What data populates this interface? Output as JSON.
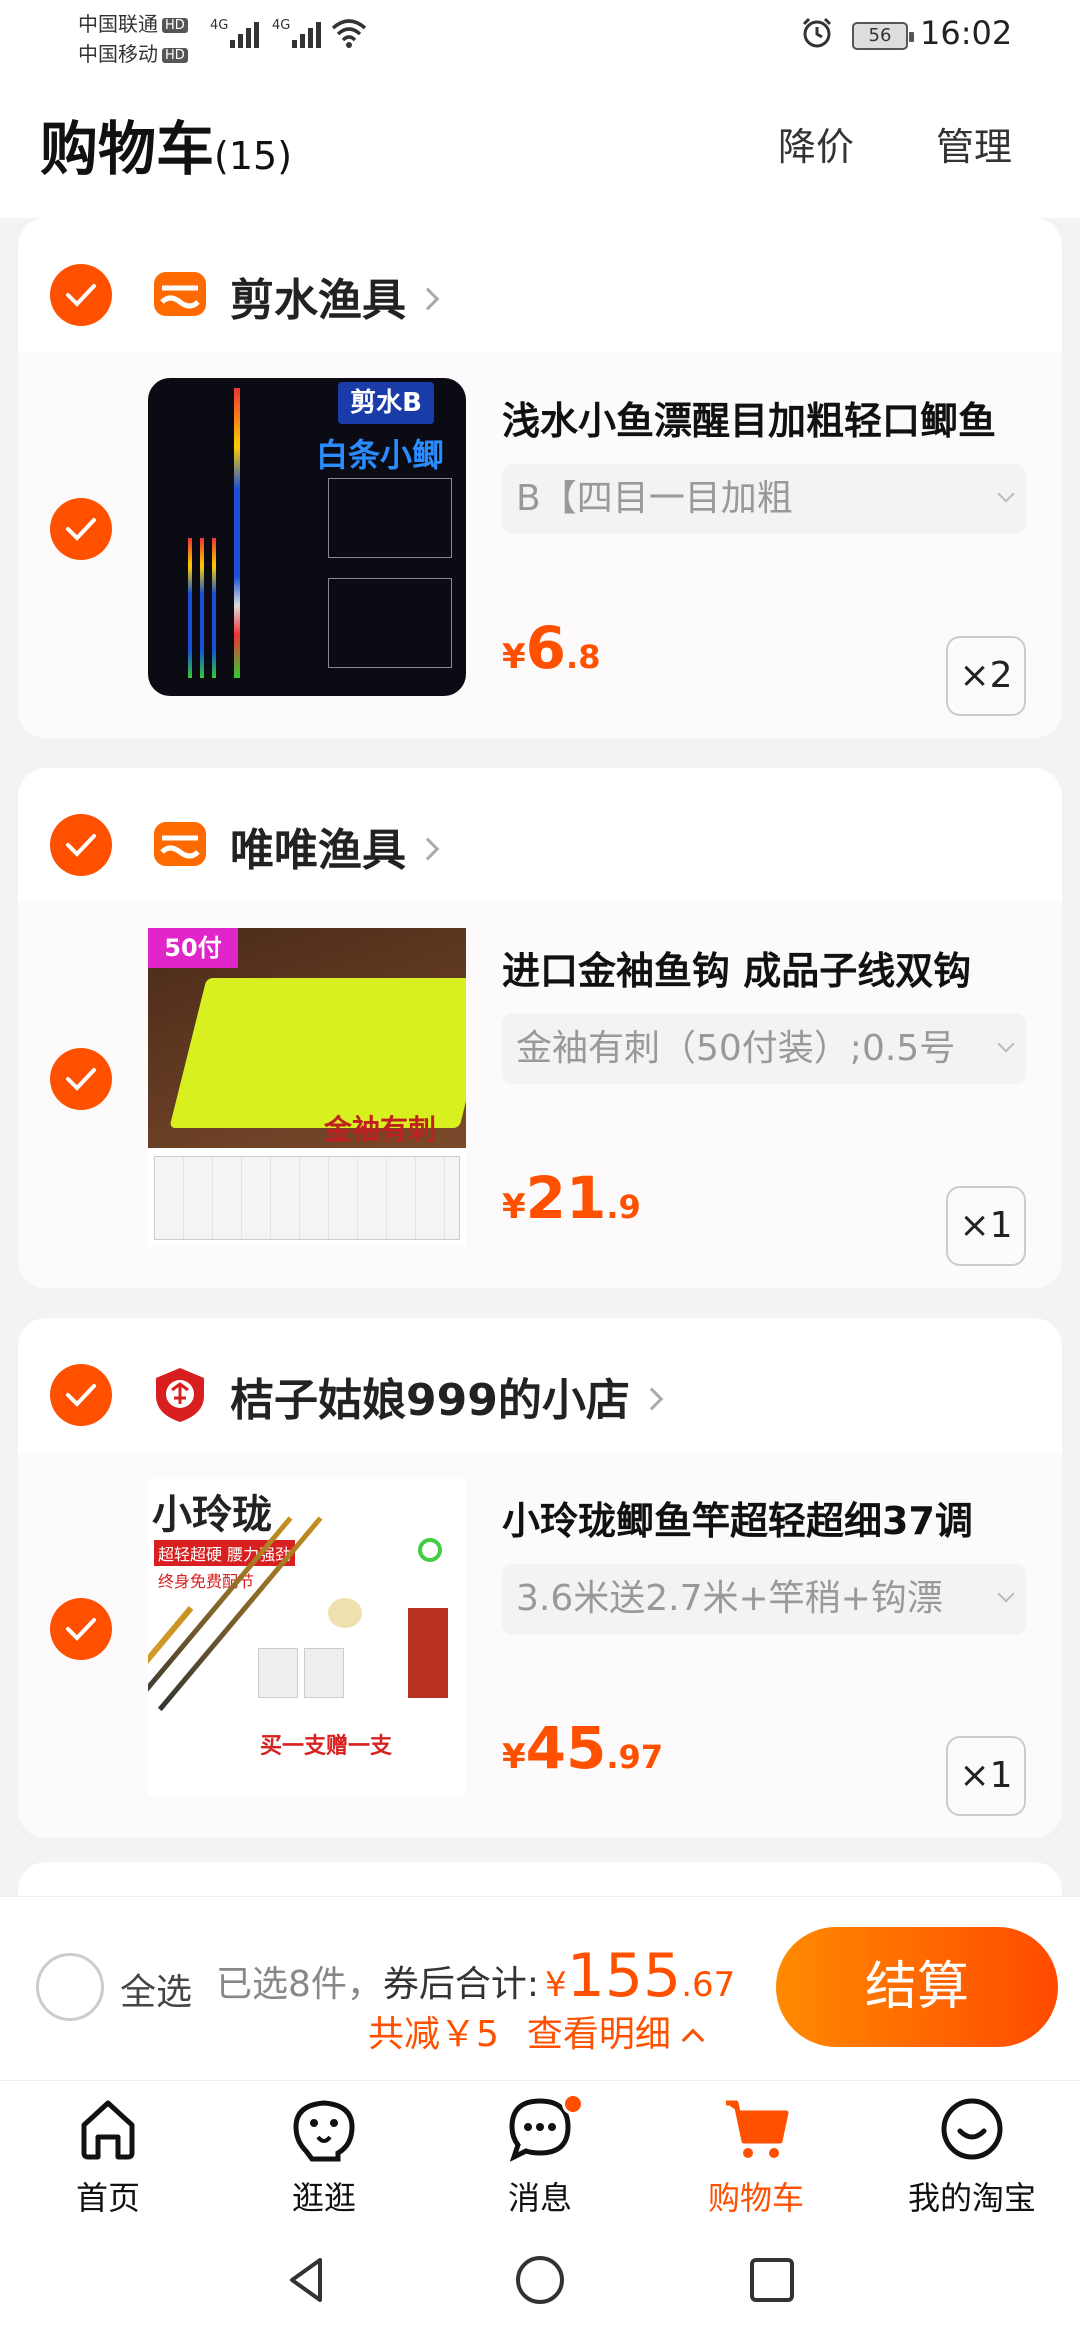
{
  "status_bar": {
    "carrier1": "中国联通",
    "carrier2": "中国移动",
    "hd": "HD",
    "signal_label": "4G",
    "battery": "56",
    "time": "16:02"
  },
  "header": {
    "title": "购物车",
    "count": "(15)",
    "price_drop": "降价",
    "manage": "管理"
  },
  "shops": [
    {
      "name": "剪水渔具",
      "logo": "store-icon",
      "item": {
        "title": "浅水小鱼漂醒目加粗轻口鲫鱼",
        "sku": "B【四目一目加粗",
        "price_cur": "¥",
        "price_int": "6",
        "price_dec": ".8",
        "qty": "×2",
        "thumb_text1": "剪水B",
        "thumb_text2": "白条小鲫"
      }
    },
    {
      "name": "唯唯渔具",
      "logo": "store-icon",
      "item": {
        "title": "进口金袖鱼钩 成品子线双钩",
        "sku": "金袖有刺（50付装）;0.5号",
        "price_cur": "¥",
        "price_int": "21",
        "price_dec": ".9",
        "qty": "×1",
        "thumb_text1": "50付",
        "thumb_text2": "金袖有刺"
      }
    },
    {
      "name": "桔子姑娘999的小店",
      "logo": "enterprise-badge-icon",
      "item": {
        "title": "小玲珑鲫鱼竿超轻超细37调",
        "sku": "3.6米送2.7米+竿稍+钩漂",
        "price_cur": "¥",
        "price_int": "45",
        "price_dec": ".97",
        "qty": "×1",
        "thumb_text1": "小玲珑",
        "thumb_text2": "超轻超硬 腰力强劲",
        "thumb_text3": "终身免费配节",
        "thumb_text4": "买一支赠一支"
      }
    }
  ],
  "checkout": {
    "select_all": "全选",
    "selected": "已选8件，",
    "total_label": "券后合计:",
    "total_cur": "¥",
    "total_int": "155",
    "total_dec": ".67",
    "discount": "共减￥5",
    "details": "查看明细",
    "pay": "结算"
  },
  "tabs": [
    {
      "label": "首页",
      "icon": "home-icon"
    },
    {
      "label": "逛逛",
      "icon": "browse-icon"
    },
    {
      "label": "消息",
      "icon": "message-icon"
    },
    {
      "label": "购物车",
      "icon": "cart-icon"
    },
    {
      "label": "我的淘宝",
      "icon": "profile-icon"
    }
  ],
  "colors": {
    "accent": "#ff5000",
    "background": "#f3f3f3"
  }
}
